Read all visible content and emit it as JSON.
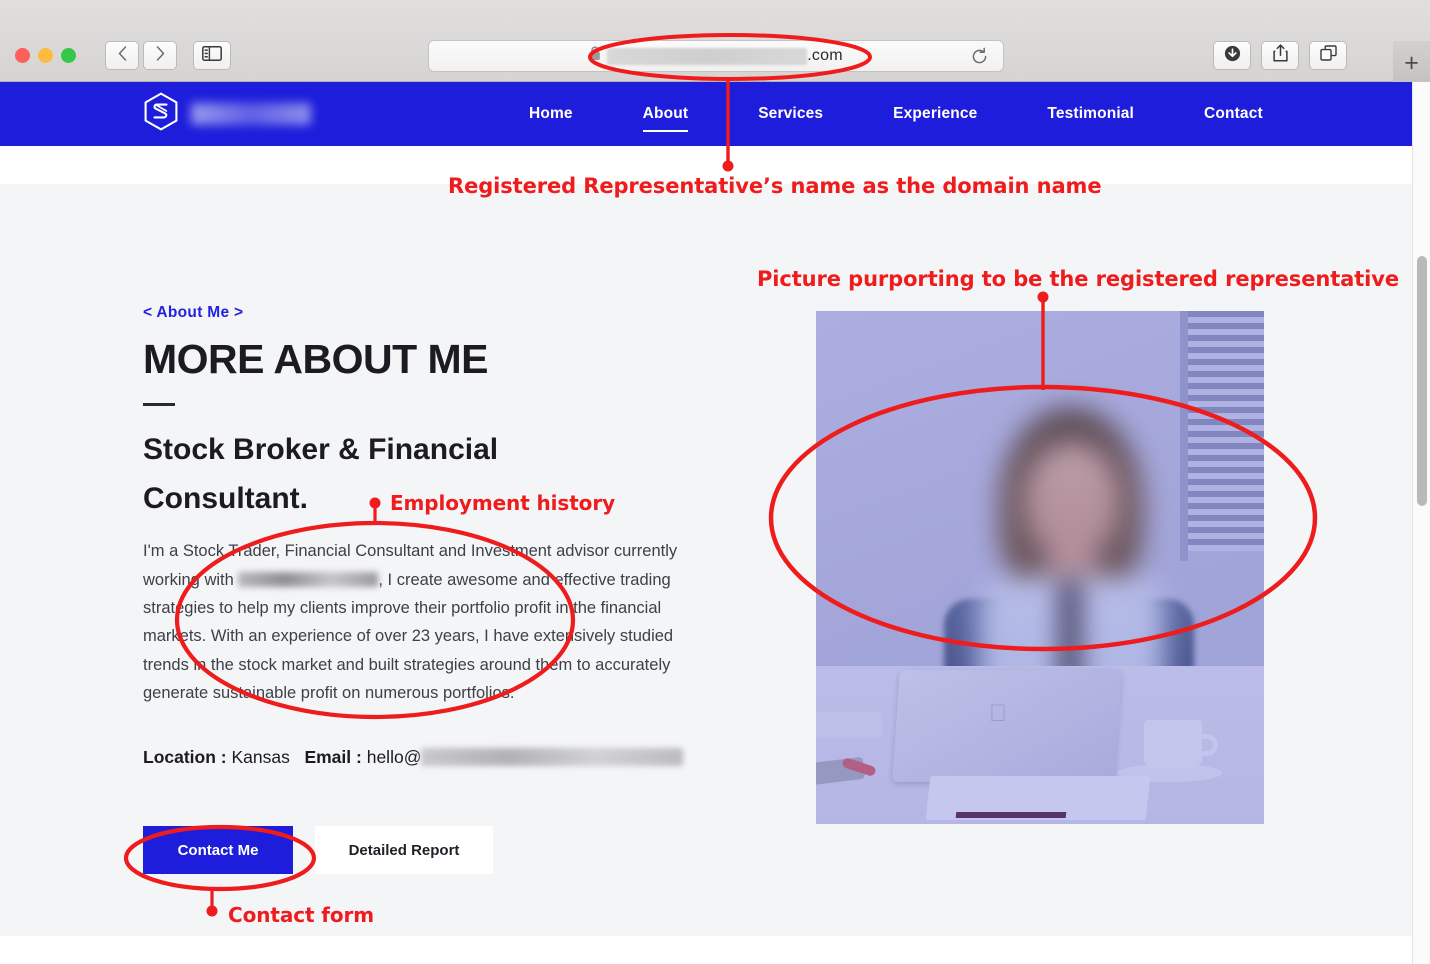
{
  "browser": {
    "traffic_lights": [
      "close",
      "minimize",
      "zoom"
    ],
    "back_icon": "chevron-left-icon",
    "forward_icon": "chevron-right-icon",
    "sidebar_icon": "sidebar-toggle-icon",
    "lock_icon": "padlock-icon",
    "url_redacted": true,
    "url_tld": ".com",
    "reload_icon": "reload-icon",
    "downloads_icon": "downloads-icon",
    "share_icon": "share-icon",
    "tabs_icon": "tab-overview-icon",
    "new_tab_label": "+"
  },
  "site": {
    "logo_icon": "hexagon-s-logo-icon",
    "brand_name_redacted": true,
    "nav": [
      {
        "label": "Home",
        "active": false
      },
      {
        "label": "About",
        "active": true
      },
      {
        "label": "Services",
        "active": false
      },
      {
        "label": "Experience",
        "active": false
      },
      {
        "label": "Testimonial",
        "active": false
      },
      {
        "label": "Contact",
        "active": false
      }
    ],
    "about": {
      "eyebrow_prefix": "<",
      "eyebrow": "About Me",
      "eyebrow_suffix": ">",
      "heading": "MORE ABOUT ME",
      "subheading": "Stock Broker & Financial Consultant.",
      "paragraph_part1": "I'm a Stock Trader, Financial Consultant and Investment advisor currently working with",
      "paragraph_part2": ", I create awesome and effective trading strategies to help my clients improve their portfolio profit in the financial markets. With an experience of over 23 years, I have extensively studied trends in the stock market and built strategies around them to accurately generate sustainable profit on numerous portfolios.",
      "location_label": "Location :",
      "location_value": "Kansas",
      "email_label": "Email :",
      "email_value": "hello@",
      "email_redacted": true,
      "primary_button": "Contact Me",
      "secondary_button": "Detailed Report"
    },
    "photo": {
      "alt": "woman at desk with laptop",
      "tint_color": "#4a4ad0"
    }
  },
  "annotations": [
    {
      "id": "domain-annotation",
      "text": "Registered Representative’s name as the domain name"
    },
    {
      "id": "photo-annotation",
      "text": "Picture purporting to be the registered representative"
    },
    {
      "id": "employment-annotation",
      "text": "Employment history"
    },
    {
      "id": "contact-annotation",
      "text": "Contact form"
    }
  ],
  "colors": {
    "brand_blue": "#1d1ddb",
    "annotation_red": "#ee1c1c",
    "page_bg": "#f4f5f7",
    "heading": "#1b1b21"
  }
}
